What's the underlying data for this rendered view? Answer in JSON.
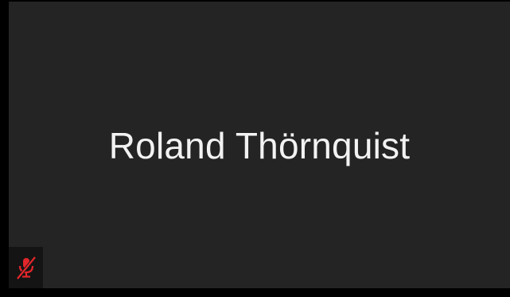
{
  "meeting_tile": {
    "participant_name": "Roland Thörnquist",
    "mic_status_icon": "microphone-muted-icon",
    "mic_status_color": "#e3262b",
    "tile_background": "#242424"
  }
}
